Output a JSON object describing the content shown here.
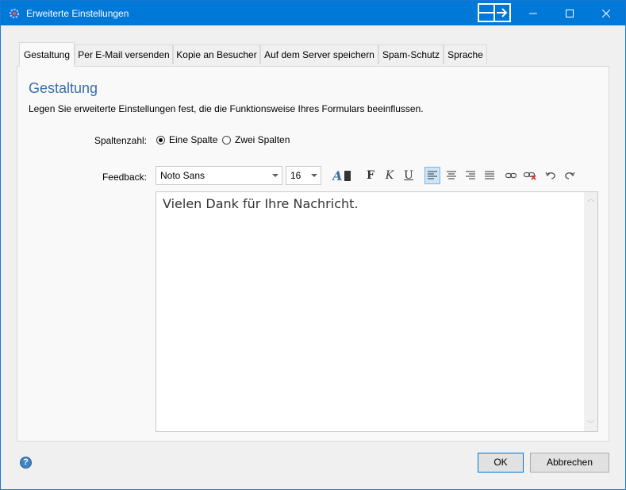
{
  "window": {
    "title": "Erweiterte Einstellungen",
    "accent": "#0078d7"
  },
  "tabs": [
    {
      "label": "Gestaltung",
      "active": true
    },
    {
      "label": "Per E-Mail versenden",
      "active": false
    },
    {
      "label": "Kopie an Besucher",
      "active": false
    },
    {
      "label": "Auf dem Server speichern",
      "active": false
    },
    {
      "label": "Spam-Schutz",
      "active": false
    },
    {
      "label": "Sprache",
      "active": false
    }
  ],
  "section": {
    "title": "Gestaltung",
    "description": "Legen Sie erweiterte Einstellungen fest, die die Funktionsweise Ihres Formulars beeinflussen."
  },
  "columns": {
    "label": "Spaltenzahl:",
    "options": [
      {
        "label": "Eine Spalte",
        "selected": true
      },
      {
        "label": "Zwei Spalten",
        "selected": false
      }
    ]
  },
  "feedback": {
    "label": "Feedback:",
    "font": "Noto Sans",
    "size": "16",
    "toolbar": {
      "color_icon": "font-color-icon",
      "bold": "F",
      "italic": "K",
      "underline": "U",
      "align_active": "left"
    },
    "text": "Vielen Dank für Ihre Nachricht."
  },
  "buttons": {
    "ok": "OK",
    "cancel": "Abbrechen",
    "help": "?"
  }
}
